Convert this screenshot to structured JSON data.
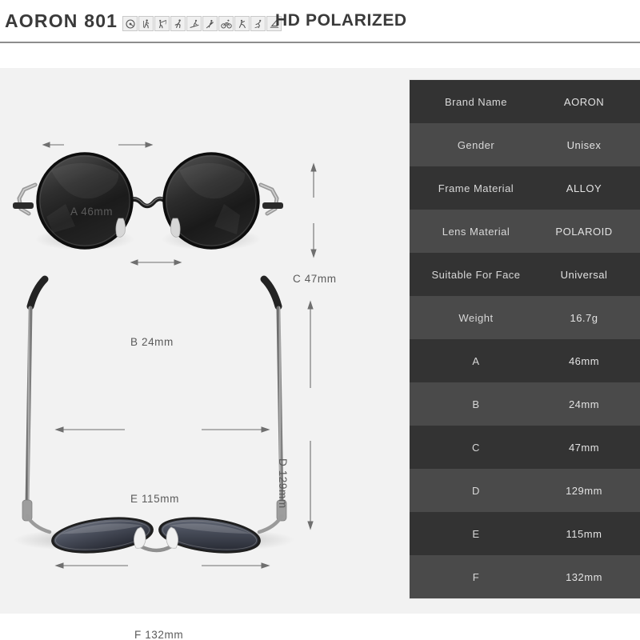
{
  "header": {
    "brand_title": "AORON 801",
    "polarized_title": "HD POLARIZED",
    "icons": [
      {
        "name": "driving-icon"
      },
      {
        "name": "hiking-icon"
      },
      {
        "name": "fishing-icon"
      },
      {
        "name": "running-icon"
      },
      {
        "name": "skiing-icon"
      },
      {
        "name": "golf-icon"
      },
      {
        "name": "cycling-icon"
      },
      {
        "name": "climbing-icon"
      },
      {
        "name": "skating-icon"
      },
      {
        "name": "sailing-icon"
      }
    ]
  },
  "product": {
    "dimensions": {
      "a": "A 46mm",
      "b": "B 24mm",
      "c": "C 47mm",
      "d": "D 129mm",
      "e": "E 115mm",
      "f": "F 132mm"
    }
  },
  "spec_table": {
    "rows": [
      {
        "label": "Brand Name",
        "value": "AORON"
      },
      {
        "label": "Gender",
        "value": "Unisex"
      },
      {
        "label": "Frame Material",
        "value": "ALLOY"
      },
      {
        "label": "Lens Material",
        "value": "POLAROID"
      },
      {
        "label": "Suitable For Face",
        "value": "Universal"
      },
      {
        "label": "Weight",
        "value": "16.7g"
      },
      {
        "label": "A",
        "value": "46mm"
      },
      {
        "label": "B",
        "value": "24mm"
      },
      {
        "label": "C",
        "value": "47mm"
      },
      {
        "label": "D",
        "value": "129mm"
      },
      {
        "label": "E",
        "value": "115mm"
      },
      {
        "label": "F",
        "value": "132mm"
      }
    ]
  },
  "colors": {
    "page_background": "#ffffff",
    "body_background": "#f2f2f2",
    "table_row_dark": "#333333",
    "table_row_light": "#4a4a4a",
    "dimension_text": "#5b5b5b",
    "title_text": "#3a3a3a"
  }
}
